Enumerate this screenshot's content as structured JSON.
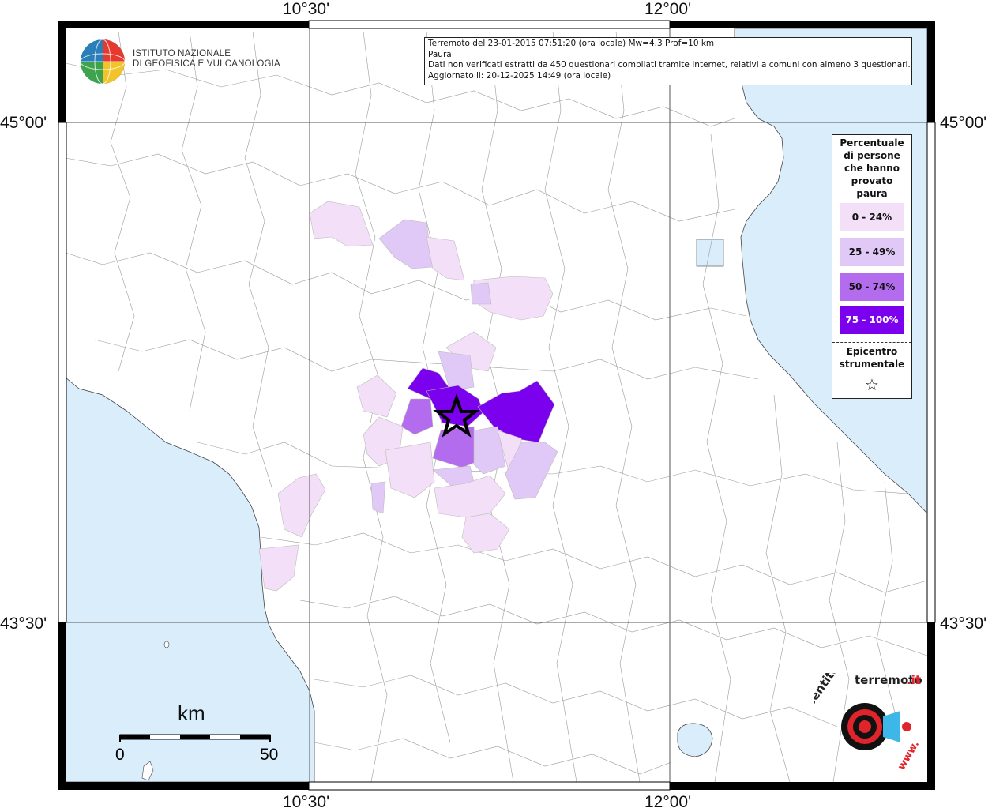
{
  "coords": {
    "top_left": "10°30'",
    "top_right": "12°00'",
    "bottom_left": "10°30'",
    "bottom_right": "12°00'",
    "left_upper": "45°00'",
    "left_lower": "43°30'",
    "right_upper": "45°00'",
    "right_lower": "43°30'"
  },
  "ingv": {
    "line1": "ISTITUTO NAZIONALE",
    "line2": "DI GEOFISICA E VULCANOLOGIA"
  },
  "info": {
    "line1": "Terremoto del 23-01-2015 07:51:20 (ora locale) Mw=4.3 Prof=10 km",
    "line2": "Paura",
    "line3": "Dati non verificati estratti da 450 questionari compilati tramite Internet, relativi a comuni con almeno 3 questionari.",
    "line4": "Aggiornato il: 20-12-2025 14:49 (ora locale)"
  },
  "legend": {
    "title_1": "Percentuale",
    "title_2": "di persone",
    "title_3": "che hanno",
    "title_4": "provato",
    "title_5": "paura",
    "classes": [
      {
        "label": "0 - 24%",
        "color": "#f4dff8"
      },
      {
        "label": "25 - 49%",
        "color": "#e0c9f6"
      },
      {
        "label": "50 - 74%",
        "color": "#b46cee"
      },
      {
        "label": "75 - 100%",
        "color": "#7b00ee"
      }
    ],
    "epicenter_1": "Epicentro",
    "epicenter_2": "strumentale",
    "epicenter_symbol": "☆"
  },
  "scale": {
    "unit": "km",
    "min": "0",
    "max": "50"
  },
  "site": {
    "name": "haisentitoilterremoto.it",
    "prefix": "www."
  },
  "colors": {
    "sea": "#d9edfb",
    "land": "#ffffff",
    "frame": "#000000"
  }
}
